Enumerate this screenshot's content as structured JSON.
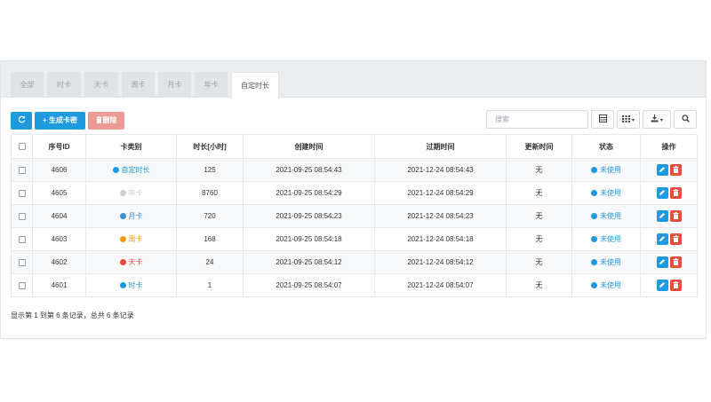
{
  "tabs": [
    {
      "label": "全部",
      "active": false
    },
    {
      "label": "时卡",
      "active": false
    },
    {
      "label": "天卡",
      "active": false
    },
    {
      "label": "周卡",
      "active": false
    },
    {
      "label": "月卡",
      "active": false
    },
    {
      "label": "年卡",
      "active": false
    },
    {
      "label": "自定时长",
      "active": true
    }
  ],
  "toolbar": {
    "refresh_icon": "refresh-icon",
    "generate_label": "+ 生成卡密",
    "delete_label": "删除",
    "delete_icon": "trash-icon",
    "search_placeholder": "搜索",
    "buttons": [
      "table-icon",
      "columns-icon",
      "export-icon",
      "search-icon"
    ]
  },
  "colors": {
    "primary": "#1e9ae0",
    "danger_soft": "#ee9a94",
    "danger": "#e74c3c",
    "custom": "#1e9ae0",
    "year": "#c9ced3",
    "month": "#3a8fd0",
    "week": "#f39c12",
    "day": "#e74c3c",
    "hour": "#1e9ae0"
  },
  "table": {
    "columns": [
      "序号ID",
      "卡类别",
      "时长[小时]",
      "创建时间",
      "过期时间",
      "更新时间",
      "状态",
      "操作"
    ],
    "rows": [
      {
        "id": "4606",
        "type": "自定时长",
        "type_color": "#1e9ae0",
        "hours": "125",
        "created": "2021-09-25 08:54:43",
        "expires": "2021-12-24 08:54:43",
        "updated": "无",
        "status": "未使用"
      },
      {
        "id": "4605",
        "type": "年卡",
        "type_color": "#c9ced3",
        "hours": "8760",
        "created": "2021-09-25 08:54:29",
        "expires": "2021-12-24 08:54:29",
        "updated": "无",
        "status": "未使用"
      },
      {
        "id": "4604",
        "type": "月卡",
        "type_color": "#3a8fd0",
        "hours": "720",
        "created": "2021-09-25 08:54:23",
        "expires": "2021-12-24 08:54:23",
        "updated": "无",
        "status": "未使用"
      },
      {
        "id": "4603",
        "type": "周卡",
        "type_color": "#f39c12",
        "hours": "168",
        "created": "2021-09-25 08:54:18",
        "expires": "2021-12-24 08:54:18",
        "updated": "无",
        "status": "未使用"
      },
      {
        "id": "4602",
        "type": "天卡",
        "type_color": "#e74c3c",
        "hours": "24",
        "created": "2021-09-25 08:54:12",
        "expires": "2021-12-24 08:54:12",
        "updated": "无",
        "status": "未使用"
      },
      {
        "id": "4601",
        "type": "时卡",
        "type_color": "#1e9ae0",
        "hours": "1",
        "created": "2021-09-25 08:54:07",
        "expires": "2021-12-24 08:54:07",
        "updated": "无",
        "status": "未使用"
      }
    ]
  },
  "footer": {
    "summary": "显示第 1 到第 6 条记录，总共 6 条记录"
  }
}
